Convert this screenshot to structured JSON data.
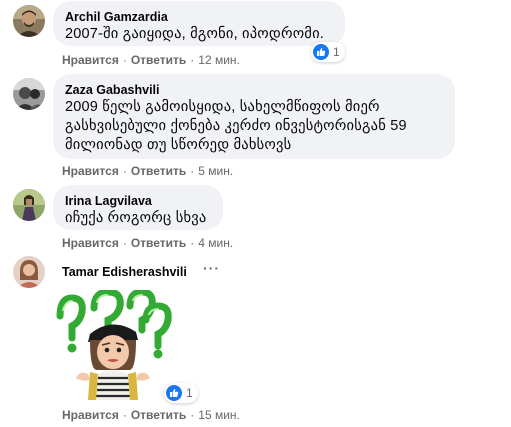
{
  "colors": {
    "bubble": "#f0f2f5",
    "meta": "#65676b",
    "like": "#1877f2"
  },
  "comments": [
    {
      "author": "Archil Gamzardia",
      "text": "2007-ში გაიყიდა, მგონი, იპოდრომი.",
      "like_label": "Нравится",
      "reply_label": "Ответить",
      "time": "12 мин.",
      "reactions": "1"
    },
    {
      "author": "Zaza Gabashvili",
      "text_lines": [
        "2009 წელს გამოისყიდა, სახელმწიფოს მიერ",
        "გასხვისებული ქონება კერძო ინვესტორისგან 59",
        "მილიონად თუ სწორედ მახსოვს"
      ],
      "like_label": "Нравится",
      "reply_label": "Ответить",
      "time": "5 мин."
    },
    {
      "author": "Irina Lagvilava",
      "text": "იჩუქა როგორც სხვა",
      "like_label": "Нравится",
      "reply_label": "Ответить",
      "time": "4 мин."
    },
    {
      "author": "Tamar Edisherashvili",
      "sticker": "confused-girl-question-marks-sticker",
      "like_label": "Нравится",
      "reply_label": "Ответить",
      "time": "15 мин.",
      "reactions": "1"
    }
  ]
}
